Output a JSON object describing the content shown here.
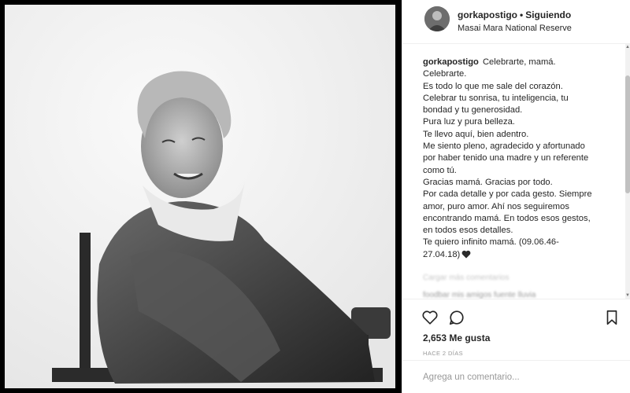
{
  "post": {
    "username": "gorkapostigo",
    "separator": "•",
    "follow_status": "Siguiendo",
    "location": "Masai Mara National Reserve"
  },
  "caption": {
    "username": "gorkapostigo",
    "lines": [
      "Celebrarte, mamá.",
      "Celebrarte.",
      "Es todo lo que me sale del corazón.",
      "Celebrar tu sonrisa, tu inteligencia, tu",
      "bondad y tu generosidad.",
      "Pura luz y pura belleza.",
      "Te llevo aquí, bien adentro.",
      "Me siento pleno, agradecido y afortunado",
      "por haber tenido una madre y un referente",
      "como tú.",
      "Gracias mamá. Gracias por todo.",
      "Por cada detalle y por cada gesto. Siempre",
      "amor, puro amor. Ahí nos seguiremos",
      "encontrando mamá. En todos esos gestos,",
      "en todos esos detalles.",
      "Te quiero infinito mamá. (09.06.46-",
      "27.04.18)"
    ],
    "emoji": "black-heart-icon"
  },
  "comments": {
    "faded": [
      "Cargar más comentarios",
      "foodbar mis amigos fuente lluvia"
    ]
  },
  "actions": {
    "like_icon": "heart-outline-icon",
    "comment_icon": "comment-bubble-icon",
    "save_icon": "bookmark-icon"
  },
  "likes": "2,653 Me gusta",
  "timestamp": "HACE 2 DÍAS",
  "add_comment": {
    "placeholder": "Agrega un comentario..."
  }
}
